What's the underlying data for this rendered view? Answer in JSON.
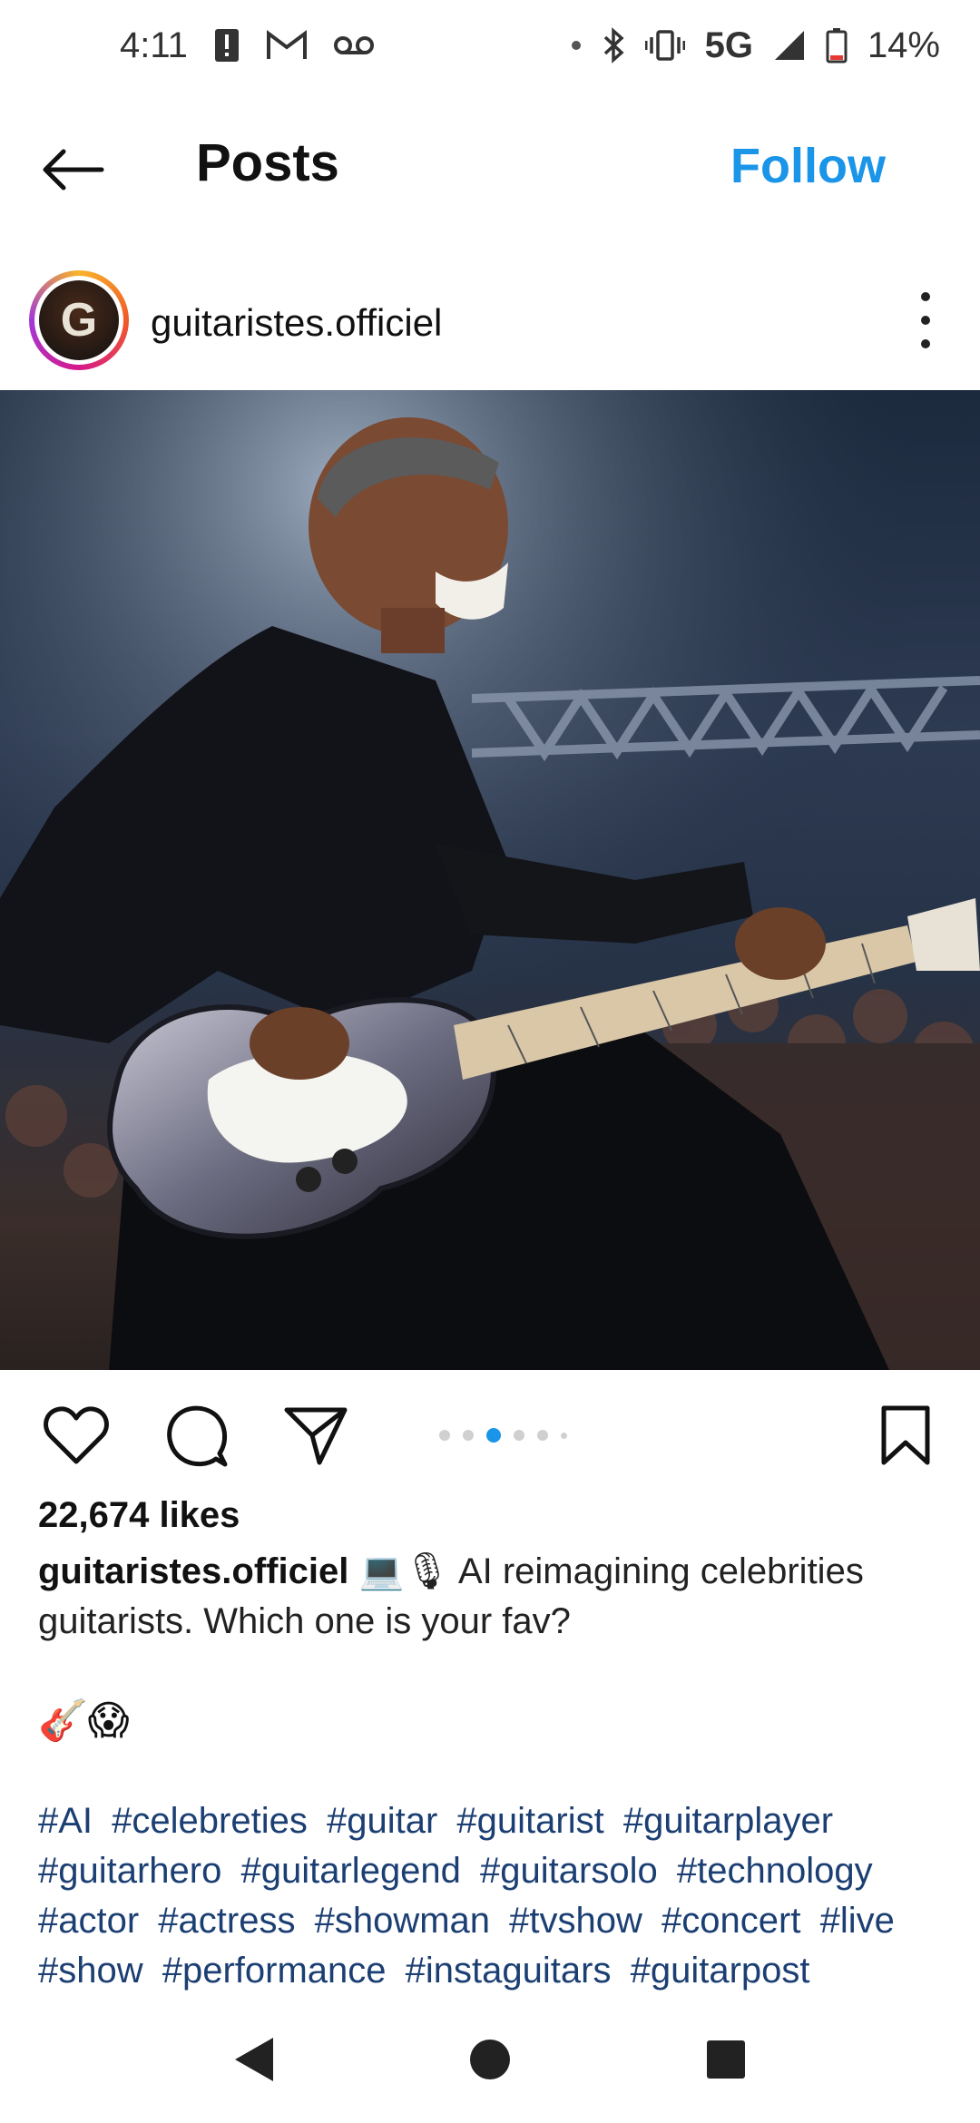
{
  "status_bar": {
    "time": "4:11",
    "network": "5G",
    "battery_pct": "14%",
    "icons": [
      "alert-icon",
      "gmail-icon",
      "voicemail-icon",
      "dot-icon",
      "bluetooth-icon",
      "vibrate-icon",
      "signal-icon",
      "battery-icon"
    ]
  },
  "header": {
    "title": "Posts",
    "follow_label": "Follow",
    "back_icon": "arrow-left-icon"
  },
  "post": {
    "avatar_letter": "G",
    "username": "guitaristes.officiel",
    "image_alt": "AI-generated image of a man playing a sparkly electric guitar on a concert stage",
    "likes": "22,674 likes",
    "caption_user": "guitaristes.officiel",
    "caption_emoji": "💻🎙",
    "caption_text": " AI reimagining celebrities guitarists. Which one is your fav?",
    "emoji_line": "🎸😱",
    "hashtags": [
      "#AI",
      "#celebreties",
      "#guitar",
      "#guitarist",
      "#guitarplayer",
      "#guitarhero",
      "#guitarlegend",
      "#guitarsolo",
      "#technology",
      "#actor",
      "#actress",
      "#showman",
      "#tvshow",
      "#concert",
      "#live",
      "#show",
      "#performance",
      "#instaguitars",
      "#guitarpost"
    ],
    "carousel": {
      "total": 6,
      "active_index": 2
    }
  },
  "colors": {
    "accent": "#1a95e8",
    "hashtag": "#1c3f73"
  }
}
